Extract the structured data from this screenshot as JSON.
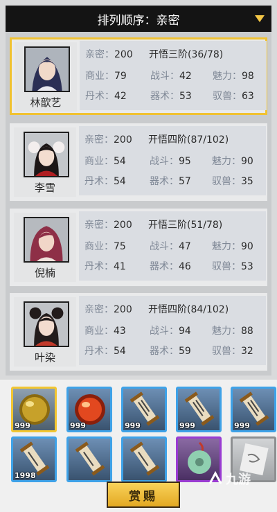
{
  "header": {
    "title": "排列顺序：亲密"
  },
  "labels": {
    "intimacy": "亲密：",
    "business": "商业：",
    "combat": "战斗：",
    "charm": "魅力：",
    "alchemy": "丹术：",
    "artifice": "器术：",
    "taming": "驭兽："
  },
  "characters": [
    {
      "name": "林歆艺",
      "intimacy": "200",
      "level": "开悟三阶(36/78)",
      "business": "79",
      "combat": "42",
      "charm": "98",
      "alchemy": "42",
      "artifice": "53",
      "taming": "63",
      "selected": true
    },
    {
      "name": "李雪",
      "intimacy": "200",
      "level": "开悟四阶(87/102)",
      "business": "54",
      "combat": "95",
      "charm": "90",
      "alchemy": "54",
      "artifice": "57",
      "taming": "35",
      "selected": false
    },
    {
      "name": "倪楠",
      "intimacy": "200",
      "level": "开悟三阶(51/78)",
      "business": "75",
      "combat": "47",
      "charm": "90",
      "alchemy": "41",
      "artifice": "46",
      "taming": "53",
      "selected": false
    },
    {
      "name": "叶染",
      "intimacy": "200",
      "level": "开悟四阶(84/102)",
      "business": "43",
      "combat": "94",
      "charm": "88",
      "alchemy": "54",
      "artifice": "59",
      "taming": "32",
      "selected": false
    }
  ],
  "items": [
    {
      "icon": "gold-orb-icon",
      "count": "999",
      "frame": "gold"
    },
    {
      "icon": "red-orb-icon",
      "count": "999",
      "frame": "blue"
    },
    {
      "icon": "scroll-icon",
      "count": "999",
      "frame": "blue"
    },
    {
      "icon": "scroll-icon",
      "count": "999",
      "frame": "blue"
    },
    {
      "icon": "scroll-icon",
      "count": "999",
      "frame": "blue"
    },
    {
      "icon": "scroll-icon",
      "count": "1998",
      "frame": "blue"
    },
    {
      "icon": "scroll-icon",
      "count": "",
      "frame": "blue"
    },
    {
      "icon": "scroll-icon",
      "count": "",
      "frame": "blue"
    },
    {
      "icon": "jade-pendant-icon",
      "count": "",
      "frame": "purple"
    },
    {
      "icon": "paper-scroll-icon",
      "count": "",
      "frame": "gray"
    }
  ],
  "reward_button": {
    "label": "赏赐"
  },
  "watermark": {
    "text": "九游"
  },
  "colors": {
    "selected_border": "#f0c232",
    "item_frame_blue": "#3ea2e8",
    "button_gold": "#f4c444"
  }
}
